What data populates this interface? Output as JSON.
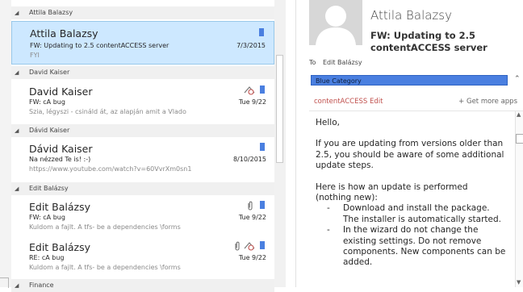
{
  "groups": [
    {
      "label": "Attila Balazsy"
    },
    {
      "label": "David Kaiser"
    },
    {
      "label": "Dávid Kaiser"
    },
    {
      "label": "Edit Balázsy"
    },
    {
      "label": "Finance"
    }
  ],
  "messages": [
    {
      "sender": "Attila Balazsy",
      "subject": "FW: Updating to 2.5 contentACCESS server",
      "preview": "FYI",
      "date": "7/3/2015",
      "selected": true
    },
    {
      "sender": "David Kaiser",
      "subject": "FW: cA bug",
      "preview": "Szia, légyszi - csináld át, az alapján amit a Vlado",
      "date": "Tue 9/22"
    },
    {
      "sender": "Dávid Kaiser",
      "subject": "Na nézzed Te is! :-)",
      "preview": "https://www.youtube.com/watch?v=60VvrXm0sn1",
      "date": "8/10/2015"
    },
    {
      "sender": "Edit Balázsy",
      "subject": "FW: cA bug",
      "preview": "Kuldom a fajlt. A tfs- be a dependencies \\forms",
      "date": "Tue 9/22"
    },
    {
      "sender": "Edit Balázsy",
      "subject": "RE: cA bug",
      "preview": "Kuldom a fajlt. A tfs- be a dependencies \\forms",
      "date": "Tue 9/22"
    }
  ],
  "reading": {
    "sender_name": "Attila Balazsy",
    "subject": "FW: Updating to 2.5 contentACCESS server",
    "to_label": "To",
    "to_value": "Edit Balázsy",
    "category": "Blue Category",
    "addin_name": "contentACCESS Edit",
    "get_more_apps": "+ Get more apps",
    "body": {
      "greeting": "Hello,",
      "para1": "If you are updating from versions older than 2.5, you should be aware of some additional update steps.",
      "para2": "Here is how an update is performed (nothing new):",
      "steps": [
        "Download and install the package. The installer is automatically started.",
        "In the wizard do not change the existing settings. Do not remove components. New components can be added."
      ]
    }
  },
  "colors": {
    "selection": "#cde8ff",
    "category_blue": "#4a7fe0",
    "addin_red": "#c0504d"
  },
  "icons": [
    "collapse-triangle-icon",
    "category-flag-icon",
    "follow-up-icon",
    "paperclip-icon",
    "scroll-up-icon",
    "scroll-down-icon",
    "collapse-caret-icon"
  ]
}
